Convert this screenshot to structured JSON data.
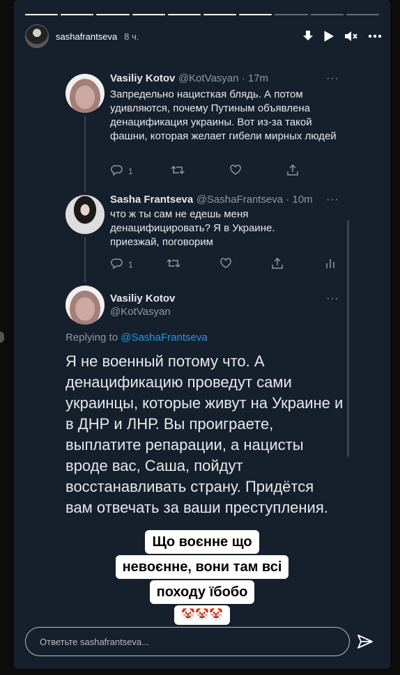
{
  "story": {
    "username": "sashafrantseva",
    "time": "8 ч.",
    "progress_total": 10,
    "progress_done": 7
  },
  "tweet1": {
    "name": "Vasiliy Kotov",
    "handle": "@KotVasyan · 17m",
    "text": "Запредельно нацисткая блядь. А потом удивляются, почему Путиным объявлена денацификация украины. Вот из-за такой фашни, которая желает гибели мирных людей",
    "replies": "1"
  },
  "tweet2": {
    "name": "Sasha Frantseva",
    "handle": "@SashaFrantseva · 10m",
    "text": "что ж ты сам не едешь меня денацифицировать? Я в Украине. приезжай, поговорим",
    "replies": "1"
  },
  "tweet3": {
    "name": "Vasiliy Kotov",
    "handle": "@KotVasyan",
    "replying_prefix": "Replying to ",
    "replying_to": "@SashaFrantseva",
    "text": "Я не военный потому что. А денацификацию проведут сами украинцы, которые живут на Украине и в ДНР и ЛНР. Вы проиграете, выплатите репарации, а нацисты вроде вас, Саша, пойдут восстанавливать страну. Придётся вам отвечать за ваши преступления."
  },
  "sticker": {
    "line1": "Що воєнне що",
    "line2": "невоєнне, вони там всі",
    "line3": "походу їбобо",
    "emoji": "🤡🤡🤡"
  },
  "reply_box": {
    "placeholder": "Ответьте sashafrantseva..."
  }
}
